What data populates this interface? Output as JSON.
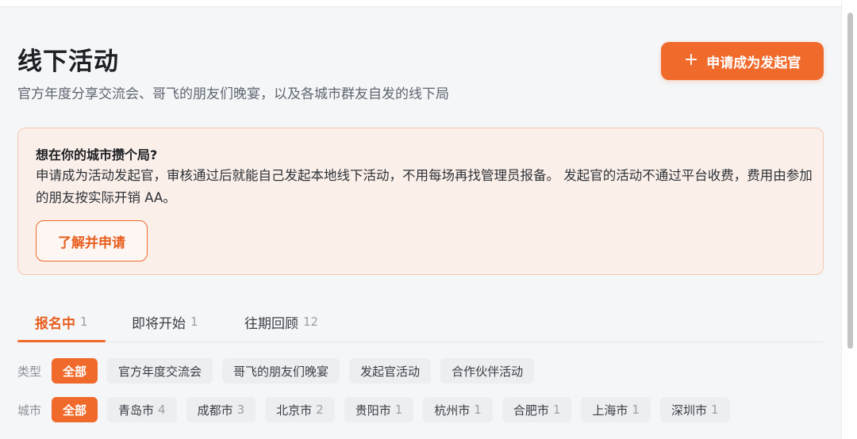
{
  "header": {
    "title": "线下活动",
    "subtitle": "官方年度分享交流会、哥飞的朋友们晚宴，以及各城市群友自发的线下局",
    "apply_button": {
      "icon": "plus-icon",
      "label": "申请成为发起官"
    }
  },
  "notice": {
    "title": "想在你的城市攒个局?",
    "body": "申请成为活动发起官，审核通过后就能自己发起本地线下活动，不用每场再找管理员报备。 发起官的活动不通过平台收费，费用由参加的朋友按实际开销 AA。",
    "button": "了解并申请"
  },
  "tabs": [
    {
      "label": "报名中",
      "count": "1",
      "active": true
    },
    {
      "label": "即将开始",
      "count": "1",
      "active": false
    },
    {
      "label": "往期回顾",
      "count": "12",
      "active": false
    }
  ],
  "filters": {
    "type": {
      "label": "类型",
      "options": [
        {
          "label": "全部",
          "active": true
        },
        {
          "label": "官方年度交流会"
        },
        {
          "label": "哥飞的朋友们晚宴"
        },
        {
          "label": "发起官活动"
        },
        {
          "label": "合作伙伴活动"
        }
      ]
    },
    "city": {
      "label": "城市",
      "options": [
        {
          "label": "全部",
          "active": true
        },
        {
          "label": "青岛市",
          "count": "4"
        },
        {
          "label": "成都市",
          "count": "3"
        },
        {
          "label": "北京市",
          "count": "2"
        },
        {
          "label": "贵阳市",
          "count": "1"
        },
        {
          "label": "杭州市",
          "count": "1"
        },
        {
          "label": "合肥市",
          "count": "1"
        },
        {
          "label": "上海市",
          "count": "1"
        },
        {
          "label": "深圳市",
          "count": "1"
        }
      ]
    }
  },
  "colors": {
    "accent": "#f06a2c",
    "notice_bg": "#fbefe9",
    "notice_border": "#f6c8b1"
  }
}
